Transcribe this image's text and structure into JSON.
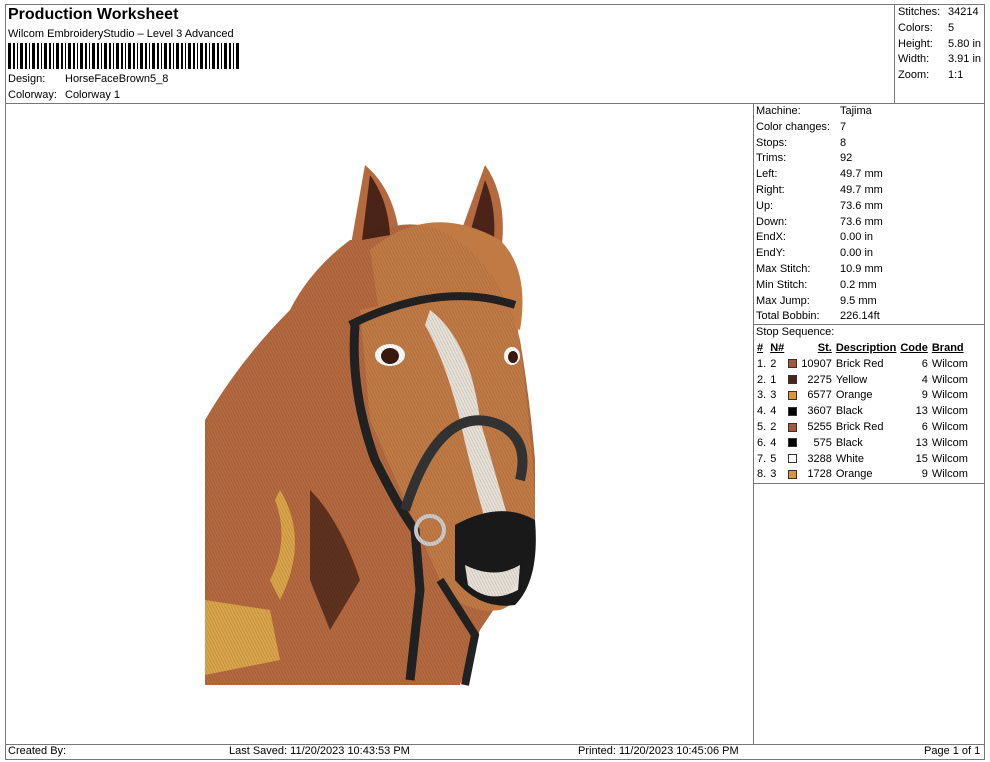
{
  "header": {
    "title": "Production Worksheet",
    "subtitle": "Wilcom EmbroideryStudio – Level 3 Advanced",
    "design_label": "Design:",
    "design_value": "HorseFaceBrown5_8",
    "colorway_label": "Colorway:",
    "colorway_value": "Colorway 1"
  },
  "summary": [
    {
      "label": "Stitches:",
      "value": "34214"
    },
    {
      "label": "Colors:",
      "value": "5"
    },
    {
      "label": "Height:",
      "value": "5.80 in"
    },
    {
      "label": "Width:",
      "value": "3.91 in"
    },
    {
      "label": "Zoom:",
      "value": "1:1"
    }
  ],
  "machine_info": [
    {
      "label": "Machine:",
      "value": "Tajima"
    },
    {
      "label": "Color changes:",
      "value": "7"
    },
    {
      "label": "Stops:",
      "value": "8"
    },
    {
      "label": "Trims:",
      "value": "92"
    },
    {
      "label": "Left:",
      "value": "49.7 mm"
    },
    {
      "label": "Right:",
      "value": "49.7 mm"
    },
    {
      "label": "Up:",
      "value": "73.6 mm"
    },
    {
      "label": "Down:",
      "value": "73.6 mm"
    },
    {
      "label": "EndX:",
      "value": "0.00 in"
    },
    {
      "label": "EndY:",
      "value": "0.00 in"
    },
    {
      "label": "Max Stitch:",
      "value": "10.9 mm"
    },
    {
      "label": "Min Stitch:",
      "value": "0.2 mm"
    },
    {
      "label": "Max Jump:",
      "value": "9.5 mm"
    },
    {
      "label": "Total Bobbin:",
      "value": "226.14ft"
    }
  ],
  "stop_sequence": {
    "title": "Stop Sequence:",
    "headers": {
      "num": "#",
      "n": "N#",
      "st": "St.",
      "description": "Description",
      "code": "Code",
      "brand": "Brand"
    },
    "rows": [
      {
        "num": "1.",
        "n": "2",
        "color": "#a0583f",
        "st": "10907",
        "description": "Brick Red",
        "code": "6",
        "brand": "Wilcom"
      },
      {
        "num": "2.",
        "n": "1",
        "color": "#4a2418",
        "st": "2275",
        "description": "Yellow",
        "code": "4",
        "brand": "Wilcom"
      },
      {
        "num": "3.",
        "n": "3",
        "color": "#d9943f",
        "st": "6577",
        "description": "Orange",
        "code": "9",
        "brand": "Wilcom"
      },
      {
        "num": "4.",
        "n": "4",
        "color": "#000000",
        "st": "3607",
        "description": "Black",
        "code": "13",
        "brand": "Wilcom"
      },
      {
        "num": "5.",
        "n": "2",
        "color": "#a0583f",
        "st": "5255",
        "description": "Brick Red",
        "code": "6",
        "brand": "Wilcom"
      },
      {
        "num": "6.",
        "n": "4",
        "color": "#000000",
        "st": "575",
        "description": "Black",
        "code": "13",
        "brand": "Wilcom"
      },
      {
        "num": "7.",
        "n": "5",
        "color": "#ffffff",
        "st": "3288",
        "description": "White",
        "code": "15",
        "brand": "Wilcom"
      },
      {
        "num": "8.",
        "n": "3",
        "color": "#d9943f",
        "st": "1728",
        "description": "Orange",
        "code": "9",
        "brand": "Wilcom"
      }
    ]
  },
  "footer": {
    "created_by": "Created By:",
    "last_saved": "Last Saved: 11/20/2023 10:43:53 PM",
    "printed": "Printed: 11/20/2023 10:45:06 PM",
    "page": "Page 1 of 1"
  },
  "preview": {
    "subject": "horse-face-embroidery",
    "colors": [
      "#a0583f",
      "#4a2418",
      "#d9943f",
      "#000000",
      "#ffffff"
    ]
  }
}
